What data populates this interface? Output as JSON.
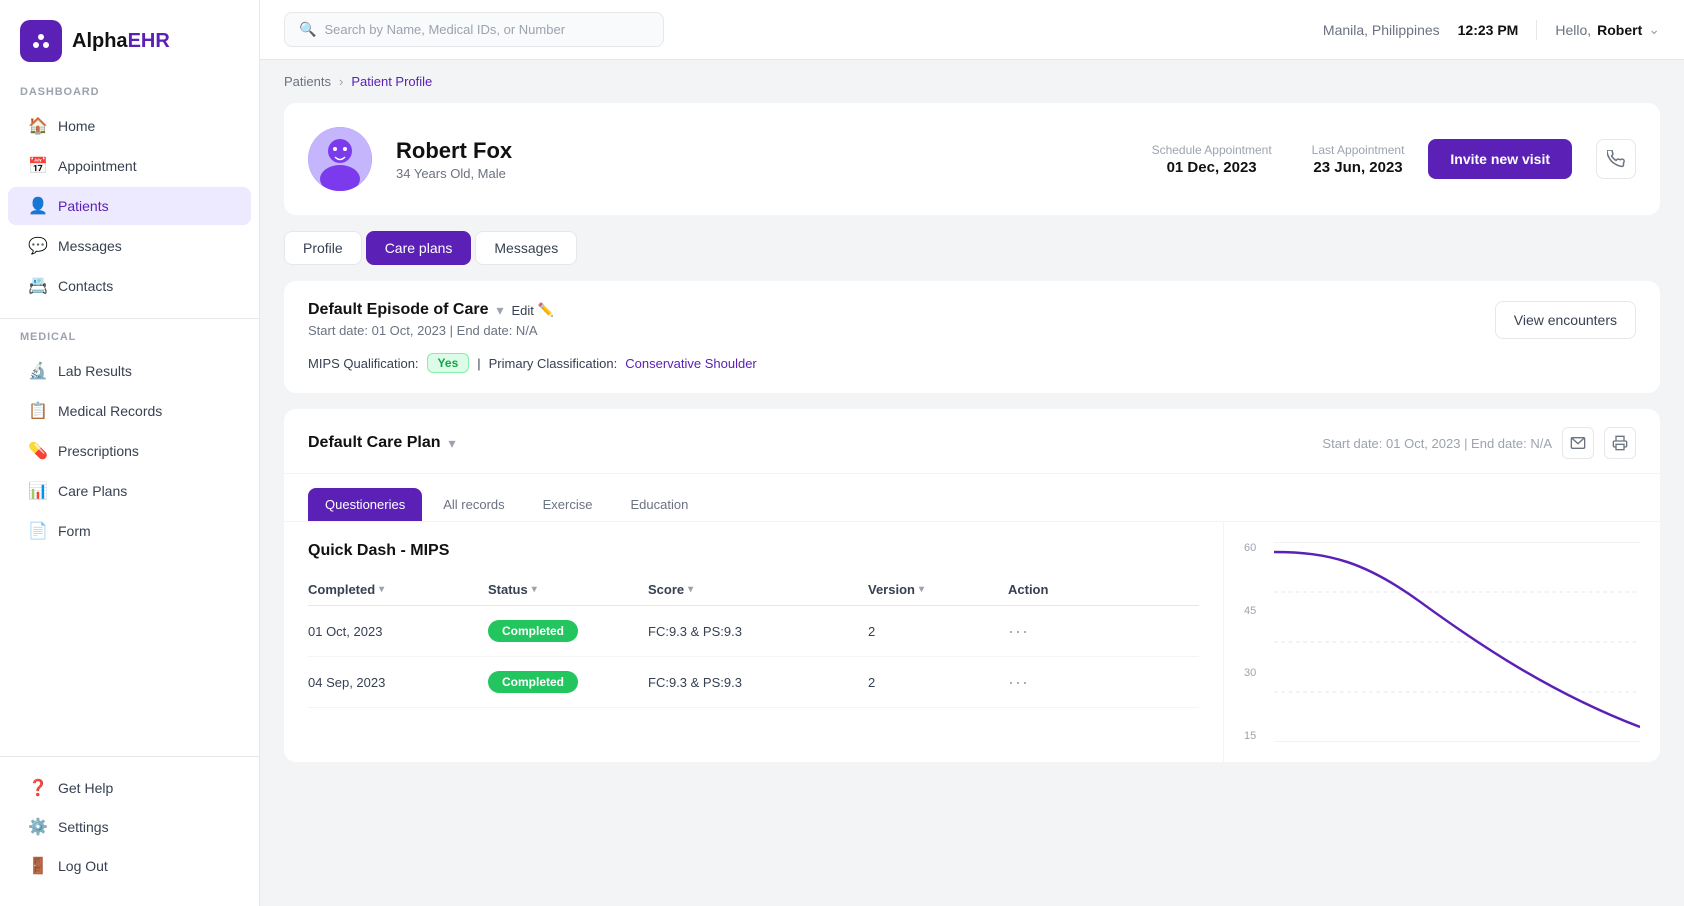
{
  "app": {
    "name": "AlphaEHR"
  },
  "topbar": {
    "search_placeholder": "Search by Name, Medical IDs, or Number",
    "location": "Manila, Philippines",
    "time": "12:23 PM",
    "greeting": "Hello,",
    "user": "Robert"
  },
  "breadcrumb": {
    "parent": "Patients",
    "current": "Patient Profile"
  },
  "patient": {
    "name": "Robert Fox",
    "age_gender": "34 Years Old, Male",
    "schedule_label": "Schedule Appointment",
    "schedule_date": "01 Dec, 2023",
    "last_label": "Last Appointment",
    "last_date": "23 Jun, 2023",
    "invite_btn": "Invite new visit"
  },
  "profile_tabs": [
    {
      "id": "profile",
      "label": "Profile"
    },
    {
      "id": "care_plans",
      "label": "Care plans"
    },
    {
      "id": "messages",
      "label": "Messages"
    }
  ],
  "episode": {
    "title": "Default Episode of Care",
    "edit_label": "Edit",
    "start_date": "Start date: 01 Oct, 2023",
    "end_date": "End date: N/A",
    "mips_label": "MIPS Qualification:",
    "mips_value": "Yes",
    "primary_label": "Primary Classification:",
    "primary_value": "Conservative Shoulder",
    "view_encounters": "View encounters"
  },
  "care_plan": {
    "title": "Default Care Plan",
    "dates": "Start date: 01 Oct, 2023 | End date: N/A",
    "tabs": [
      {
        "id": "questioneries",
        "label": "Questioneries"
      },
      {
        "id": "all_records",
        "label": "All records"
      },
      {
        "id": "exercise",
        "label": "Exercise"
      },
      {
        "id": "education",
        "label": "Education"
      }
    ],
    "quick_dash_title": "Quick Dash - MIPS",
    "table_headers": {
      "completed": "Completed",
      "status": "Status",
      "score": "Score",
      "version": "Version",
      "action": "Action"
    },
    "rows": [
      {
        "completed": "01 Oct, 2023",
        "status": "Completed",
        "score": "FC:9.3 & PS:9.3",
        "version": "2"
      },
      {
        "completed": "04 Sep, 2023",
        "status": "Completed",
        "score": "FC:9.3 & PS:9.3",
        "version": "2"
      }
    ]
  },
  "chart": {
    "y_labels": [
      "60",
      "45",
      "30",
      "15"
    ],
    "color": "#5b21b6"
  },
  "sidebar": {
    "dashboard_section": "DASHBOARD",
    "medical_section": "MEDICAL",
    "items_dashboard": [
      {
        "id": "home",
        "label": "Home",
        "icon": "🏠"
      },
      {
        "id": "appointment",
        "label": "Appointment",
        "icon": "📅"
      },
      {
        "id": "patients",
        "label": "Patients",
        "icon": "👤"
      },
      {
        "id": "messages",
        "label": "Messages",
        "icon": "💬"
      },
      {
        "id": "contacts",
        "label": "Contacts",
        "icon": "📇"
      }
    ],
    "items_medical": [
      {
        "id": "lab_results",
        "label": "Lab Results",
        "icon": "🔬"
      },
      {
        "id": "medical_records",
        "label": "Medical Records",
        "icon": "📋"
      },
      {
        "id": "prescriptions",
        "label": "Prescriptions",
        "icon": "💊"
      },
      {
        "id": "care_plans",
        "label": "Care Plans",
        "icon": "📊"
      },
      {
        "id": "form",
        "label": "Form",
        "icon": "📄"
      }
    ],
    "bottom_items": [
      {
        "id": "get_help",
        "label": "Get Help",
        "icon": "❓"
      },
      {
        "id": "settings",
        "label": "Settings",
        "icon": "⚙️"
      },
      {
        "id": "log_out",
        "label": "Log Out",
        "icon": "🚪"
      }
    ]
  }
}
